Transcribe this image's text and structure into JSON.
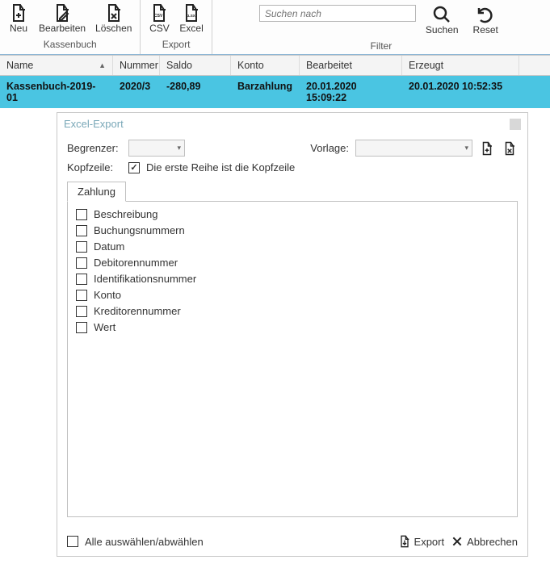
{
  "ribbon": {
    "kassenbuch": {
      "label": "Kassenbuch",
      "neu": "Neu",
      "bearbeiten": "Bearbeiten",
      "loeschen": "Löschen"
    },
    "export": {
      "label": "Export",
      "csv": "CSV",
      "excel": "Excel"
    },
    "filter": {
      "label": "Filter",
      "search_placeholder": "Suchen nach",
      "suchen": "Suchen",
      "reset": "Reset"
    }
  },
  "grid": {
    "headers": {
      "name": "Name",
      "nummer": "Nummer",
      "saldo": "Saldo",
      "konto": "Konto",
      "bearbeitet": "Bearbeitet",
      "erzeugt": "Erzeugt"
    },
    "rows": [
      {
        "name": "Kassenbuch-2019-01",
        "nummer": "2020/3",
        "saldo": "-280,89",
        "konto": "Barzahlung",
        "bearbeitet": "20.01.2020 15:09:22",
        "erzeugt": "20.01.2020 10:52:35"
      }
    ]
  },
  "dialog": {
    "title": "Excel-Export",
    "begrenzer_label": "Begrenzer:",
    "vorlage_label": "Vorlage:",
    "kopfzeile_label": "Kopfzeile:",
    "kopfzeile_text": "Die erste Reihe ist die Kopfzeile",
    "tab_label": "Zahlung",
    "fields": [
      "Beschreibung",
      "Buchungsnummern",
      "Datum",
      "Debitorennummer",
      "Identifikationsnummer",
      "Konto",
      "Kreditorennummer",
      "Wert"
    ],
    "select_all": "Alle auswählen/abwählen",
    "export_btn": "Export",
    "cancel_btn": "Abbrechen"
  }
}
